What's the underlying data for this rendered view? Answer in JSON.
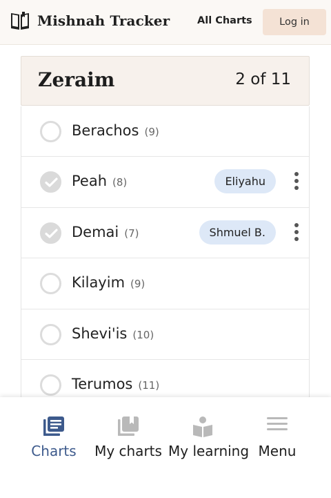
{
  "header": {
    "app_name": "Mishnah Tracker",
    "nav_all_charts": "All Charts",
    "login_label": "Log in",
    "logo_icon": "open-book-icon"
  },
  "section": {
    "title": "Zeraim",
    "progress": "2 of 11",
    "items": [
      {
        "name": "Berachos",
        "count": "(9)",
        "done": false,
        "assignee": ""
      },
      {
        "name": "Peah",
        "count": "(8)",
        "done": true,
        "assignee": "Eliyahu"
      },
      {
        "name": "Demai",
        "count": "(7)",
        "done": true,
        "assignee": "Shmuel B."
      },
      {
        "name": "Kilayim",
        "count": "(9)",
        "done": false,
        "assignee": ""
      },
      {
        "name": "Shevi'is",
        "count": "(10)",
        "done": false,
        "assignee": ""
      },
      {
        "name": "Terumos",
        "count": "(11)",
        "done": false,
        "assignee": ""
      }
    ]
  },
  "tabs": [
    {
      "label": "Charts",
      "icon": "charts-icon",
      "active": true
    },
    {
      "label": "My charts",
      "icon": "my-charts-icon",
      "active": false
    },
    {
      "label": "My learning",
      "icon": "my-learning-icon",
      "active": false
    },
    {
      "label": "Menu",
      "icon": "menu-icon",
      "active": false
    }
  ],
  "colors": {
    "header_bg": "#fbf8f5",
    "card_head_bg": "#f7f1ec",
    "login_bg": "#f4e2d5",
    "tag_bg": "#dde8f7",
    "active_tab": "#3d5a8c",
    "inactive_icon": "#b9b9b9"
  }
}
